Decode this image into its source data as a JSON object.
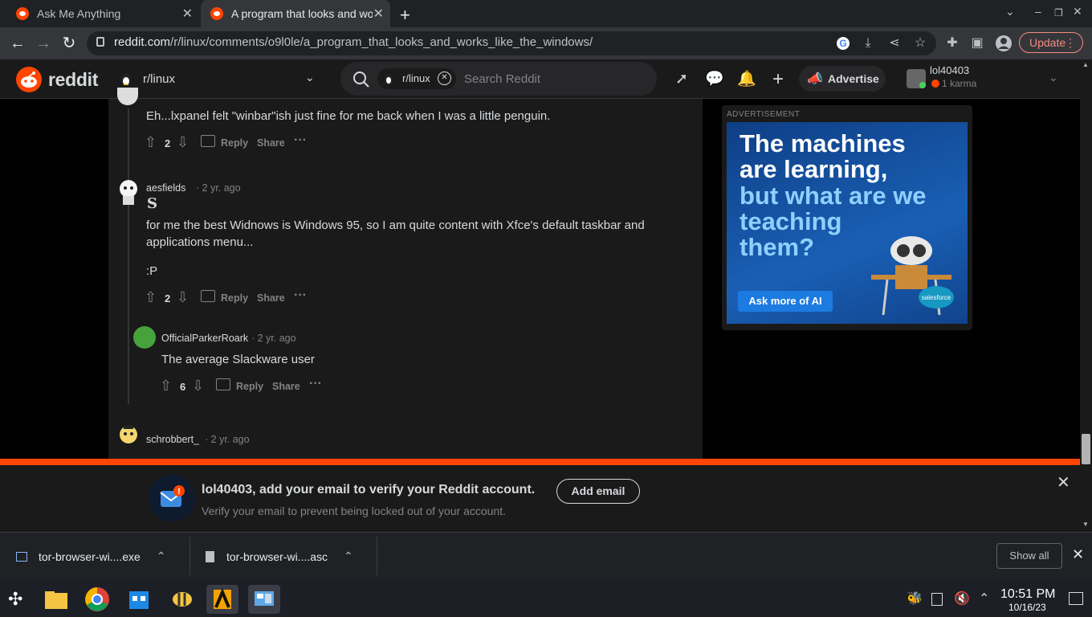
{
  "browser": {
    "tabs": [
      {
        "title": "Ask Me Anything",
        "active": false
      },
      {
        "title": "A program that looks and works like the windows",
        "active": true
      }
    ],
    "url_host": "reddit.com",
    "url_path": "/r/linux/comments/o9l0le/a_program_that_looks_and_works_like_the_windows/",
    "update_label": "Update"
  },
  "reddit": {
    "wordmark": "reddit",
    "community": "r/linux",
    "search_chip": "r/linux",
    "search_placeholder": "Search Reddit",
    "advertise_label": "Advertise",
    "user": {
      "name": "lol40403",
      "karma": "1 karma"
    }
  },
  "comments": [
    {
      "text": "Eh...lxpanel felt \"winbar\"ish just fine for me back when I was a little penguin.",
      "votes": "2",
      "reply": "Reply",
      "share": "Share"
    },
    {
      "user": "aesfields",
      "time": "2 yr. ago",
      "flair": "S",
      "text1": "for me the best Widnows is Windows 95, so I am quite content with Xfce's default taskbar and",
      "text2": "applications menu...",
      "text3": ":P",
      "votes": "2",
      "reply": "Reply",
      "share": "Share"
    },
    {
      "user": "OfficialParkerRoark",
      "time": "2 yr. ago",
      "text": "The average Slackware user",
      "votes": "6",
      "reply": "Reply",
      "share": "Share"
    },
    {
      "user": "schrobbert_",
      "time": "2 yr. ago"
    }
  ],
  "ad": {
    "label": "ADVERTISEMENT",
    "line1": "The machines",
    "line2": "are learning,",
    "line3": "but what are we",
    "line4": "teaching",
    "line5": "them?",
    "cta": "Ask more of AI",
    "brand": "salesforce"
  },
  "banner": {
    "title": "lol40403, add your email to verify your Reddit account.",
    "subtitle": "Verify your email to prevent being locked out of your account.",
    "button": "Add email"
  },
  "downloads": {
    "items": [
      "tor-browser-wi....exe",
      "tor-browser-wi....asc"
    ],
    "show_all": "Show all"
  },
  "taskbar": {
    "time": "10:51 PM",
    "date": "10/16/23"
  },
  "colors": {
    "reddit_orange": "#ff4500",
    "dark_bg": "#1a1a1b",
    "text": "#d7dadc",
    "muted": "#818384"
  }
}
